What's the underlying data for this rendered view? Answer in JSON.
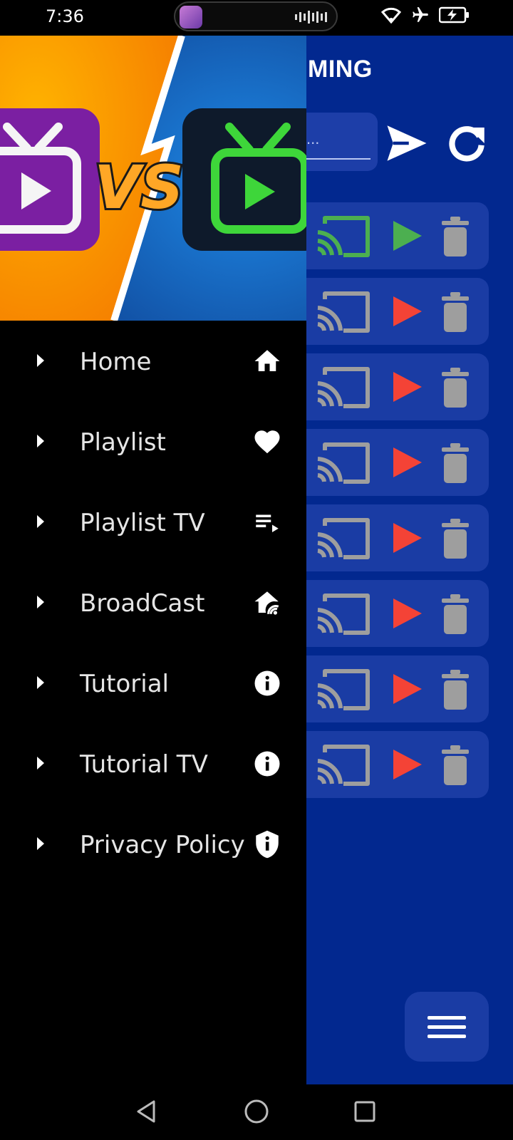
{
  "status_bar": {
    "time": "7:36"
  },
  "app": {
    "title": "MING",
    "url_input": {
      "placeholder": "..."
    },
    "streams": [
      {
        "casting": true,
        "state": "playing"
      },
      {
        "casting": false,
        "state": "stopped"
      },
      {
        "casting": false,
        "state": "stopped"
      },
      {
        "casting": false,
        "state": "stopped"
      },
      {
        "casting": false,
        "state": "stopped"
      },
      {
        "casting": false,
        "state": "stopped"
      },
      {
        "casting": false,
        "state": "stopped"
      },
      {
        "casting": false,
        "state": "stopped"
      }
    ],
    "colors": {
      "background": "#02288f",
      "row": "#1a3ca4",
      "cast_active": "#4caf50",
      "cast_inactive": "#9e9e9e",
      "play_active": "#4caf50",
      "play_inactive": "#f44336"
    }
  },
  "drawer": {
    "header": {
      "versus_text": "VS"
    },
    "menu": [
      {
        "label": "Home",
        "icon": "home-icon"
      },
      {
        "label": "Playlist",
        "icon": "heart-icon"
      },
      {
        "label": "Playlist TV",
        "icon": "playlist-play-icon"
      },
      {
        "label": "BroadCast",
        "icon": "broadcast-home-icon"
      },
      {
        "label": "Tutorial",
        "icon": "info-icon"
      },
      {
        "label": "Tutorial TV",
        "icon": "info-icon"
      },
      {
        "label": "Privacy Policy",
        "icon": "shield-info-icon"
      }
    ]
  },
  "nav_bar": {
    "buttons": [
      "back-icon",
      "home-circle-icon",
      "recents-icon"
    ]
  }
}
